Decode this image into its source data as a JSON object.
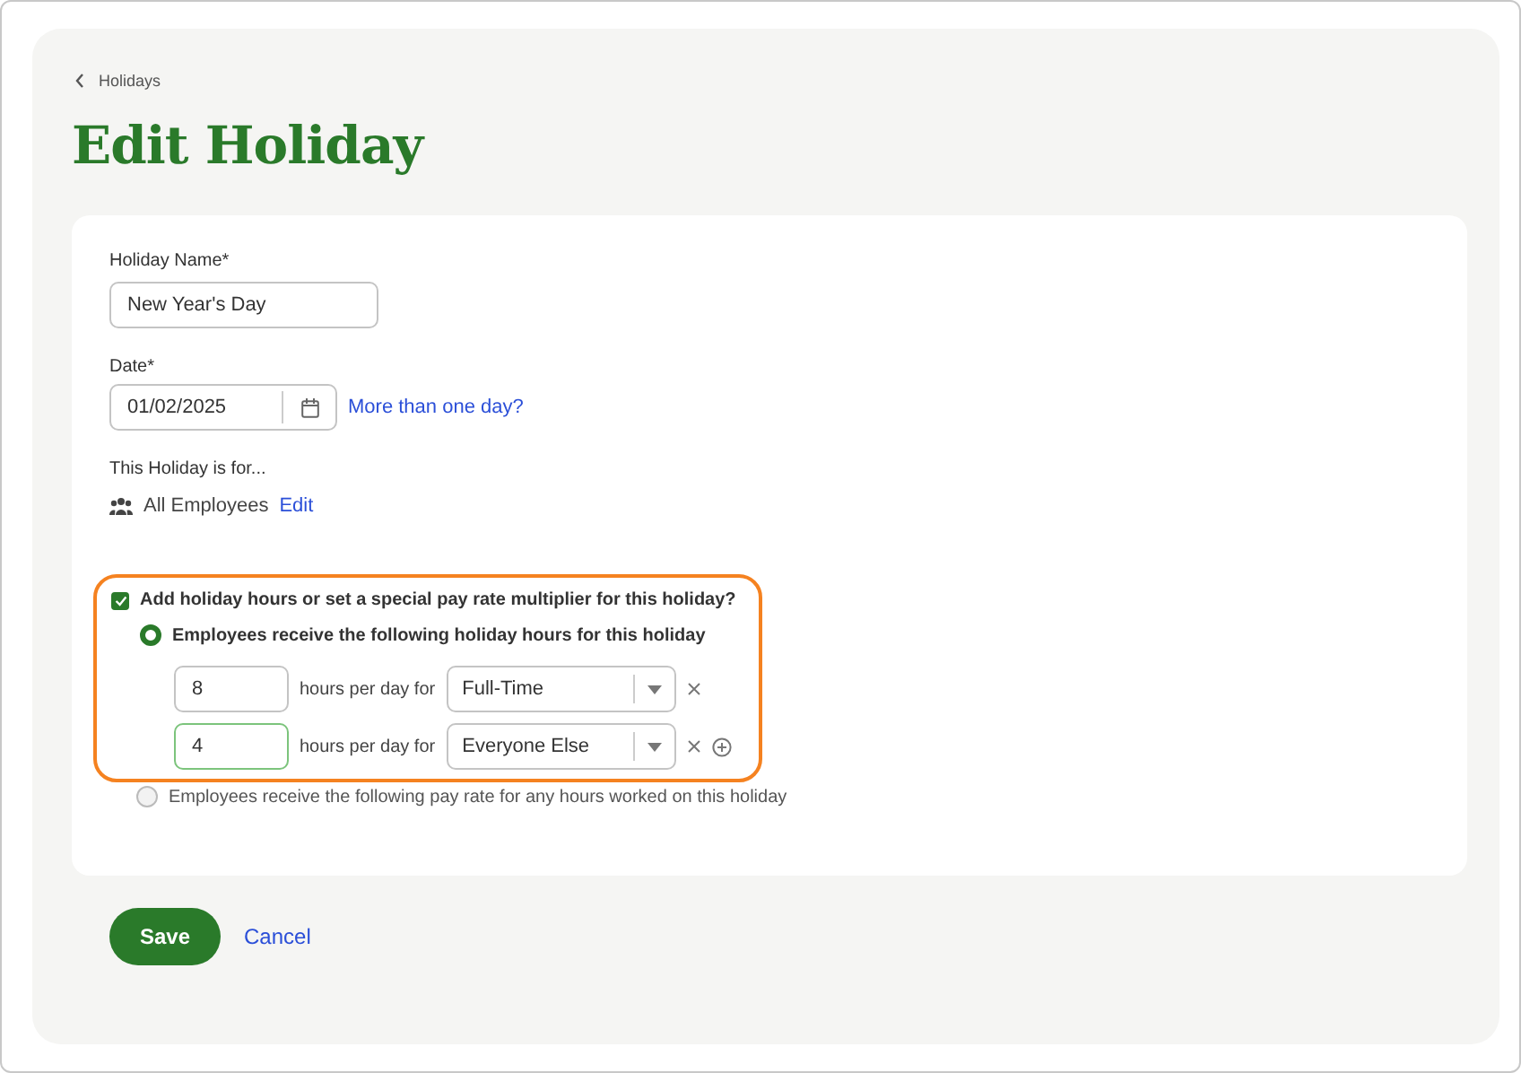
{
  "breadcrumb": {
    "label": "Holidays"
  },
  "title": "Edit Holiday",
  "form": {
    "name_label": "Holiday Name*",
    "name_value": "New Year's Day",
    "date_label": "Date*",
    "date_value": "01/02/2025",
    "date_link": "More than one day?",
    "for_label": "This Holiday is for...",
    "for_value": "All Employees",
    "for_link": "Edit",
    "special": {
      "label": "Add holiday hours or set a special pay rate multiplier for this holiday?",
      "checked": true,
      "highlighted": true,
      "options": [
        {
          "label": "Employees receive the following holiday hours for this holiday",
          "selected": true,
          "rows": [
            {
              "hours": "8",
              "unit": "hours per day for",
              "group": "Full-Time",
              "focused": false,
              "can_add": false
            },
            {
              "hours": "4",
              "unit": "hours per day for",
              "group": "Everyone Else",
              "focused": true,
              "can_add": true
            }
          ]
        },
        {
          "label": "Employees receive the following pay rate for any hours worked on this holiday",
          "selected": false
        }
      ]
    }
  },
  "actions": {
    "save": "Save",
    "cancel": "Cancel"
  }
}
